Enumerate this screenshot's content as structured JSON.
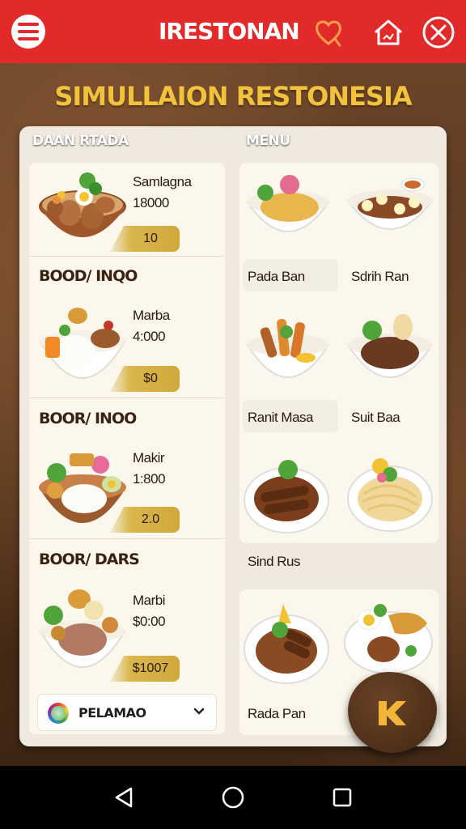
{
  "app": {
    "title": "IRESTONAN"
  },
  "page": {
    "heading": "SIMULLAION RESTONESIA"
  },
  "left_panel": {
    "label": "DAAN RTADA",
    "dishes": [
      {
        "name": "Samlagna",
        "price": "18000",
        "tag": "10",
        "category": null
      },
      {
        "name": "Marba",
        "price": "4:000",
        "tag": "$0",
        "category": "BOOD/ INQO"
      },
      {
        "name": "Makir",
        "price": "1:800",
        "tag": "2.0",
        "category": "BOOR/ INOO"
      },
      {
        "name": "Marbi",
        "price": "$0:00",
        "tag": "$1007",
        "category": "BOOR/ DARS"
      }
    ],
    "select": {
      "value": "PELAMAO"
    }
  },
  "right_panel": {
    "label": "MENU",
    "items": [
      {
        "label": "Pada Ban"
      },
      {
        "label": "Sdrih Ran"
      },
      {
        "label": "Ranit Masa"
      },
      {
        "label": "Suit Baa"
      },
      {
        "label": "Sind Rus"
      },
      {
        "label": "Rada Pan"
      }
    ]
  },
  "colors": {
    "topbar": "#e32a2a",
    "heading": "#f2c23c",
    "panel": "#efe9df",
    "fab": "#4a2c16",
    "fab_icon": "#f2b53a"
  },
  "icons": {
    "menu": "hamburger-icon",
    "heart": "heart-icon",
    "home": "home-icon",
    "close": "close-icon",
    "fab": "k-icon",
    "nav_back": "back-icon",
    "nav_home": "home-circle-icon",
    "nav_recent": "recent-icon"
  }
}
